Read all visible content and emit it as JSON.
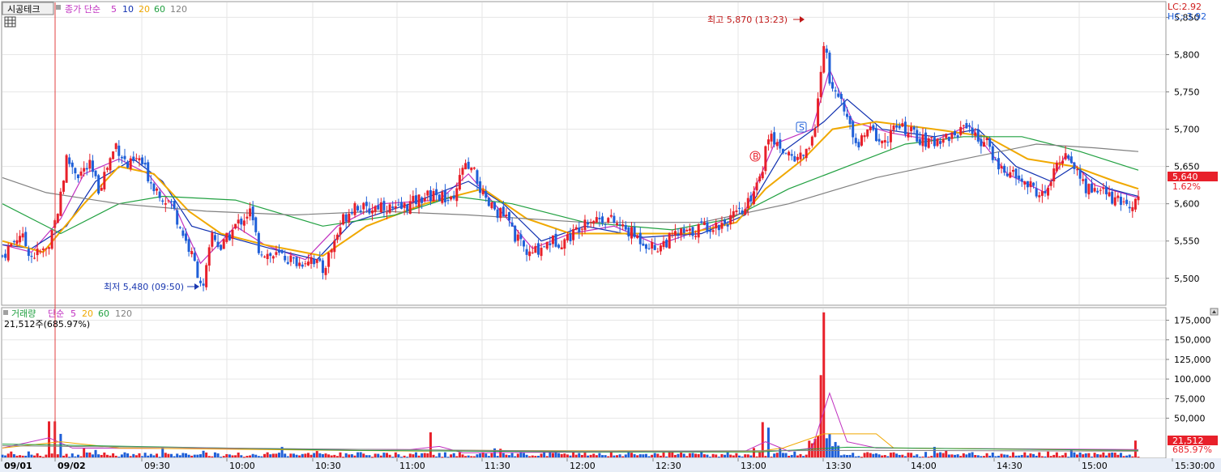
{
  "header": {
    "stock_name": "시공테크",
    "price_legend": {
      "label": "종가 단순",
      "periods": [
        "5",
        "10",
        "20",
        "60",
        "120"
      ]
    },
    "volume_legend": {
      "label": "거래량",
      "ma_label": "단순",
      "periods": [
        "5",
        "20",
        "60",
        "120"
      ]
    },
    "volume_value": "21,512주(685.97%)",
    "lc": "LC:2.92",
    "hc": "HC:-3.92"
  },
  "colors": {
    "up": "#e8202a",
    "down": "#1f5fd8",
    "ma5": "#c030c0",
    "ma10": "#1030b0",
    "ma20": "#f0a800",
    "ma60": "#20a040",
    "ma120": "#808080",
    "high_annot": "#c01818",
    "low_annot": "#1a38b0"
  },
  "chart_data": [
    {
      "type": "candlestick",
      "title": "시공테크",
      "xlabel": "",
      "ylabel": "",
      "x_ticks": [
        "09/01",
        "09/02",
        "09:30",
        "10:00",
        "10:30",
        "11:00",
        "11:30",
        "12:00",
        "12:30",
        "13:00",
        "13:30",
        "14:00",
        "14:30",
        "15:00",
        "15:30:00"
      ],
      "y_ticks": [
        "5,850",
        "5,800",
        "5,750",
        "5,700",
        "5,650",
        "5,600",
        "5,550",
        "5,500"
      ],
      "ylim": [
        5465,
        5870
      ],
      "current_price": "5,640",
      "current_change": "1.62%",
      "annotations": {
        "high": {
          "text": "최고 5,870 (13:23)",
          "value": 5870
        },
        "low": {
          "text": "최저 5,480 (09:50)",
          "value": 5480
        },
        "buy_marker": "B",
        "sell_marker": "S"
      },
      "price_path": [
        [
          0,
          5530
        ],
        [
          6,
          5560
        ],
        [
          10,
          5530
        ],
        [
          16,
          5540
        ],
        [
          20,
          5610
        ],
        [
          22,
          5660
        ],
        [
          26,
          5640
        ],
        [
          30,
          5650
        ],
        [
          33,
          5620
        ],
        [
          36,
          5650
        ],
        [
          39,
          5680
        ],
        [
          43,
          5650
        ],
        [
          47,
          5660
        ],
        [
          51,
          5630
        ],
        [
          55,
          5610
        ],
        [
          58,
          5600
        ],
        [
          61,
          5570
        ],
        [
          66,
          5520
        ],
        [
          69,
          5485
        ],
        [
          72,
          5560
        ],
        [
          75,
          5540
        ],
        [
          80,
          5570
        ],
        [
          85,
          5590
        ],
        [
          88,
          5540
        ],
        [
          92,
          5530
        ],
        [
          96,
          5530
        ],
        [
          102,
          5520
        ],
        [
          106,
          5530
        ],
        [
          110,
          5510
        ],
        [
          113,
          5540
        ],
        [
          117,
          5580
        ],
        [
          121,
          5600
        ],
        [
          125,
          5590
        ],
        [
          130,
          5600
        ],
        [
          135,
          5590
        ],
        [
          140,
          5600
        ],
        [
          145,
          5610
        ],
        [
          150,
          5610
        ],
        [
          155,
          5600
        ],
        [
          158,
          5650
        ],
        [
          162,
          5640
        ],
        [
          166,
          5600
        ],
        [
          170,
          5590
        ],
        [
          173,
          5580
        ],
        [
          177,
          5550
        ],
        [
          181,
          5530
        ],
        [
          184,
          5540
        ],
        [
          188,
          5550
        ],
        [
          192,
          5550
        ],
        [
          196,
          5560
        ],
        [
          200,
          5580
        ],
        [
          204,
          5580
        ],
        [
          208,
          5580
        ],
        [
          212,
          5570
        ],
        [
          216,
          5560
        ],
        [
          220,
          5550
        ],
        [
          224,
          5540
        ],
        [
          228,
          5550
        ],
        [
          232,
          5560
        ],
        [
          236,
          5560
        ],
        [
          240,
          5570
        ],
        [
          245,
          5570
        ],
        [
          250,
          5580
        ],
        [
          255,
          5590
        ],
        [
          258,
          5620
        ],
        [
          261,
          5650
        ],
        [
          263,
          5690
        ],
        [
          266,
          5680
        ],
        [
          269,
          5670
        ],
        [
          272,
          5660
        ],
        [
          276,
          5670
        ],
        [
          279,
          5700
        ],
        [
          282,
          5820
        ],
        [
          284,
          5770
        ],
        [
          287,
          5750
        ],
        [
          291,
          5700
        ],
        [
          294,
          5680
        ],
        [
          298,
          5700
        ],
        [
          302,
          5680
        ],
        [
          306,
          5700
        ],
        [
          310,
          5700
        ],
        [
          314,
          5690
        ],
        [
          318,
          5680
        ],
        [
          323,
          5690
        ],
        [
          327,
          5690
        ],
        [
          331,
          5710
        ],
        [
          334,
          5690
        ],
        [
          338,
          5680
        ],
        [
          342,
          5650
        ],
        [
          346,
          5640
        ],
        [
          350,
          5630
        ],
        [
          354,
          5620
        ],
        [
          358,
          5610
        ],
        [
          362,
          5650
        ],
        [
          365,
          5670
        ],
        [
          368,
          5650
        ],
        [
          372,
          5620
        ],
        [
          376,
          5620
        ],
        [
          380,
          5610
        ],
        [
          384,
          5600
        ],
        [
          387,
          5600
        ],
        [
          390,
          5610
        ]
      ],
      "ma_series": [
        {
          "name": "5",
          "values": [
            [
              0,
              5545
            ],
            [
              10,
              5535
            ],
            [
              20,
              5580
            ],
            [
              28,
              5640
            ],
            [
              40,
              5660
            ],
            [
              50,
              5640
            ],
            [
              60,
              5590
            ],
            [
              68,
              5520
            ],
            [
              80,
              5570
            ],
            [
              90,
              5545
            ],
            [
              104,
              5525
            ],
            [
              115,
              5570
            ],
            [
              130,
              5600
            ],
            [
              150,
              5605
            ],
            [
              160,
              5640
            ],
            [
              170,
              5595
            ],
            [
              182,
              5540
            ],
            [
              195,
              5560
            ],
            [
              210,
              5570
            ],
            [
              225,
              5545
            ],
            [
              240,
              5565
            ],
            [
              255,
              5590
            ],
            [
              265,
              5680
            ],
            [
              278,
              5700
            ],
            [
              284,
              5780
            ],
            [
              292,
              5710
            ],
            [
              305,
              5695
            ],
            [
              320,
              5685
            ],
            [
              332,
              5705
            ],
            [
              345,
              5640
            ],
            [
              358,
              5615
            ],
            [
              365,
              5665
            ],
            [
              375,
              5625
            ],
            [
              390,
              5608
            ]
          ]
        },
        {
          "name": "10",
          "values": [
            [
              0,
              5545
            ],
            [
              10,
              5540
            ],
            [
              22,
              5570
            ],
            [
              32,
              5630
            ],
            [
              45,
              5660
            ],
            [
              55,
              5630
            ],
            [
              65,
              5570
            ],
            [
              78,
              5555
            ],
            [
              92,
              5540
            ],
            [
              108,
              5525
            ],
            [
              120,
              5575
            ],
            [
              140,
              5600
            ],
            [
              160,
              5630
            ],
            [
              172,
              5600
            ],
            [
              185,
              5550
            ],
            [
              200,
              5570
            ],
            [
              220,
              5555
            ],
            [
              240,
              5560
            ],
            [
              255,
              5585
            ],
            [
              268,
              5670
            ],
            [
              282,
              5710
            ],
            [
              290,
              5740
            ],
            [
              302,
              5700
            ],
            [
              320,
              5690
            ],
            [
              335,
              5700
            ],
            [
              348,
              5650
            ],
            [
              360,
              5630
            ],
            [
              368,
              5650
            ],
            [
              380,
              5620
            ],
            [
              390,
              5610
            ]
          ]
        },
        {
          "name": "20",
          "values": [
            [
              0,
              5550
            ],
            [
              14,
              5535
            ],
            [
              28,
              5600
            ],
            [
              40,
              5650
            ],
            [
              52,
              5640
            ],
            [
              64,
              5590
            ],
            [
              75,
              5560
            ],
            [
              90,
              5545
            ],
            [
              110,
              5530
            ],
            [
              125,
              5570
            ],
            [
              145,
              5600
            ],
            [
              165,
              5620
            ],
            [
              180,
              5580
            ],
            [
              195,
              5560
            ],
            [
              215,
              5560
            ],
            [
              235,
              5560
            ],
            [
              252,
              5575
            ],
            [
              262,
              5620
            ],
            [
              275,
              5660
            ],
            [
              285,
              5700
            ],
            [
              300,
              5710
            ],
            [
              320,
              5700
            ],
            [
              338,
              5690
            ],
            [
              352,
              5660
            ],
            [
              368,
              5650
            ],
            [
              382,
              5630
            ],
            [
              390,
              5620
            ]
          ]
        },
        {
          "name": "60",
          "values": [
            [
              0,
              5600
            ],
            [
              20,
              5560
            ],
            [
              40,
              5600
            ],
            [
              55,
              5610
            ],
            [
              80,
              5605
            ],
            [
              110,
              5570
            ],
            [
              135,
              5585
            ],
            [
              155,
              5610
            ],
            [
              175,
              5600
            ],
            [
              200,
              5575
            ],
            [
              230,
              5565
            ],
            [
              250,
              5580
            ],
            [
              270,
              5620
            ],
            [
              290,
              5650
            ],
            [
              310,
              5680
            ],
            [
              330,
              5690
            ],
            [
              350,
              5690
            ],
            [
              370,
              5670
            ],
            [
              390,
              5645
            ]
          ]
        },
        {
          "name": "120",
          "values": [
            [
              0,
              5635
            ],
            [
              15,
              5615
            ],
            [
              40,
              5600
            ],
            [
              70,
              5590
            ],
            [
              100,
              5585
            ],
            [
              130,
              5590
            ],
            [
              160,
              5585
            ],
            [
              200,
              5575
            ],
            [
              240,
              5575
            ],
            [
              270,
              5600
            ],
            [
              300,
              5635
            ],
            [
              330,
              5660
            ],
            [
              355,
              5680
            ],
            [
              375,
              5675
            ],
            [
              390,
              5670
            ]
          ]
        }
      ]
    },
    {
      "type": "bar",
      "title": "거래량",
      "xlabel": "",
      "ylabel": "",
      "y_ticks": [
        "175,000",
        "150,000",
        "125,000",
        "100,000",
        "75,000",
        "50,000"
      ],
      "ylim": [
        0,
        190000
      ],
      "current_volume": "21,512",
      "current_ratio": "685.97%",
      "spikes": [
        {
          "x": 16,
          "value": 46000,
          "dir": "up"
        },
        {
          "x": 18,
          "value": 46000,
          "dir": "up"
        },
        {
          "x": 20,
          "value": 30000,
          "dir": "down"
        },
        {
          "x": 147,
          "value": 32000,
          "dir": "up"
        },
        {
          "x": 261,
          "value": 45000,
          "dir": "up"
        },
        {
          "x": 263,
          "value": 38000,
          "dir": "down"
        },
        {
          "x": 281,
          "value": 105000,
          "dir": "up"
        },
        {
          "x": 282,
          "value": 185000,
          "dir": "up"
        },
        {
          "x": 284,
          "value": 30000,
          "dir": "down"
        },
        {
          "x": 389,
          "value": 21512,
          "dir": "up"
        }
      ],
      "ma_series": [
        {
          "name": "5",
          "values": [
            [
              0,
              12000
            ],
            [
              16,
              25000
            ],
            [
              24,
              12000
            ],
            [
              140,
              10000
            ],
            [
              150,
              14000
            ],
            [
              158,
              6000
            ],
            [
              255,
              8000
            ],
            [
              262,
              20000
            ],
            [
              270,
              8000
            ],
            [
              278,
              12000
            ],
            [
              284,
              82000
            ],
            [
              290,
              20000
            ],
            [
              300,
              12000
            ],
            [
              390,
              10000
            ]
          ]
        },
        {
          "name": "20",
          "values": [
            [
              0,
              12000
            ],
            [
              20,
              20000
            ],
            [
              40,
              12000
            ],
            [
              145,
              8000
            ],
            [
              160,
              9000
            ],
            [
              260,
              8000
            ],
            [
              268,
              12000
            ],
            [
              282,
              30000
            ],
            [
              300,
              30000
            ],
            [
              306,
              12000
            ],
            [
              390,
              9000
            ]
          ]
        },
        {
          "name": "60",
          "values": [
            [
              0,
              17000
            ],
            [
              60,
              13000
            ],
            [
              120,
              9000
            ],
            [
              200,
              7000
            ],
            [
              260,
              7000
            ],
            [
              290,
              13000
            ],
            [
              330,
              11000
            ],
            [
              390,
              9000
            ]
          ]
        },
        {
          "name": "120",
          "values": [
            [
              0,
              15000
            ],
            [
              100,
              11000
            ],
            [
              200,
              8000
            ],
            [
              300,
              9000
            ],
            [
              390,
              8000
            ]
          ]
        }
      ]
    }
  ]
}
